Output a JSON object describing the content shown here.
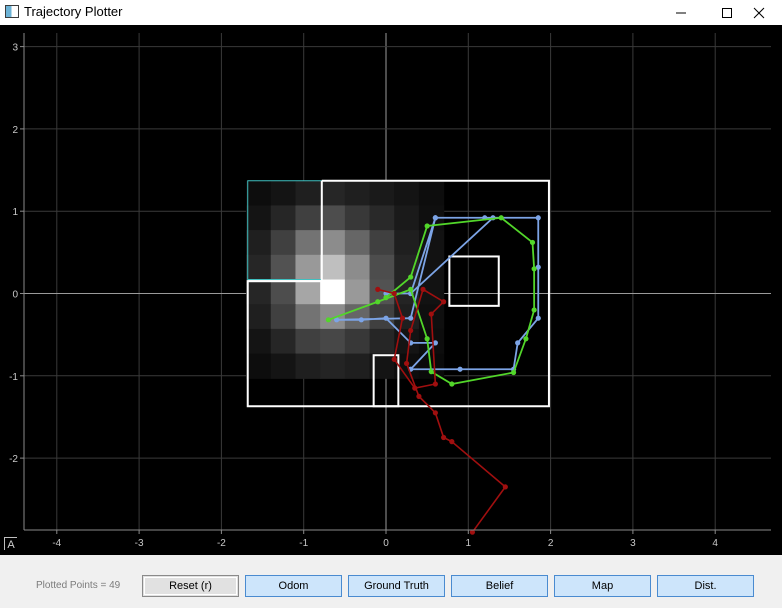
{
  "window": {
    "title": "Trajectory Plotter",
    "icons": [
      "app-icon",
      "minimize-icon",
      "maximize-icon",
      "close-icon"
    ]
  },
  "plot": {
    "x_ticks": [
      "-4",
      "-3",
      "-2",
      "-1",
      "0",
      "1",
      "2",
      "3",
      "4"
    ],
    "y_ticks": [
      "3",
      "2",
      "1",
      "0",
      "-1",
      "-2"
    ],
    "auto_range_label": "A",
    "colors": {
      "background": "#000000",
      "grid": "#3a3a3a",
      "axis": "#8a8a8a",
      "map_lines": "#ffffff",
      "odom": "#a00f0f",
      "ground_truth": "#52d62a",
      "belief": "#7ca4e6",
      "grid_highlight": "#40c0c0"
    }
  },
  "chart_data": {
    "type": "scatter",
    "xlim": [
      -4.4,
      4.7
    ],
    "ylim": [
      -2.9,
      3.1
    ],
    "grid": true,
    "series": [
      {
        "key": "belief",
        "points": [
          [
            0,
            0
          ],
          [
            0.3,
            0
          ],
          [
            0.6,
            0.92
          ],
          [
            1.2,
            0.92
          ],
          [
            1.85,
            0.92
          ],
          [
            1.85,
            0.32
          ],
          [
            1.85,
            -0.3
          ],
          [
            1.6,
            -0.6
          ],
          [
            1.55,
            -0.92
          ],
          [
            0.9,
            -0.92
          ],
          [
            0.3,
            -0.92
          ],
          [
            0.6,
            -0.6
          ],
          [
            0.3,
            -0.6
          ],
          [
            0,
            -0.3
          ],
          [
            -0.3,
            -0.32
          ],
          [
            -0.6,
            -0.32
          ],
          [
            0.3,
            -0.3
          ],
          [
            0.6,
            0.92
          ],
          [
            1.3,
            0.92
          ],
          [
            0.3,
            0
          ]
        ]
      },
      {
        "key": "ground_truth",
        "points": [
          [
            -0.7,
            -0.32
          ],
          [
            -0.1,
            -0.1
          ],
          [
            0.3,
            0.05
          ],
          [
            0.5,
            -0.55
          ],
          [
            0.55,
            -0.95
          ],
          [
            0.8,
            -1.1
          ],
          [
            1.55,
            -0.96
          ],
          [
            1.7,
            -0.55
          ],
          [
            1.8,
            -0.2
          ],
          [
            1.8,
            0.3
          ],
          [
            1.78,
            0.62
          ],
          [
            1.4,
            0.92
          ],
          [
            0.5,
            0.82
          ],
          [
            0.3,
            0.2
          ],
          [
            0,
            -0.05
          ]
        ]
      },
      {
        "key": "odom",
        "points": [
          [
            -0.1,
            0.05
          ],
          [
            0.1,
            0
          ],
          [
            0.2,
            -0.3
          ],
          [
            0.1,
            -0.8
          ],
          [
            0.35,
            -1.15
          ],
          [
            0.6,
            -1.1
          ],
          [
            0.55,
            -0.25
          ],
          [
            0.7,
            -0.1
          ],
          [
            0.45,
            0.05
          ],
          [
            0.3,
            -0.45
          ],
          [
            0.25,
            -0.85
          ],
          [
            0.4,
            -1.25
          ],
          [
            0.6,
            -1.45
          ],
          [
            0.7,
            -1.75
          ],
          [
            0.8,
            -1.8
          ],
          [
            1.45,
            -2.35
          ],
          [
            1.05,
            -2.9
          ]
        ]
      }
    ],
    "heatmap": {
      "origin": [
        -1.7,
        1.37
      ],
      "rows": [
        [
          0.05,
          0.08,
          0.12,
          0.15,
          0.12,
          0.1,
          0.08,
          0.05
        ],
        [
          0.08,
          0.15,
          0.25,
          0.3,
          0.22,
          0.16,
          0.1,
          0.06
        ],
        [
          0.12,
          0.25,
          0.45,
          0.55,
          0.4,
          0.25,
          0.12,
          0.07
        ],
        [
          0.15,
          0.32,
          0.6,
          0.75,
          0.55,
          0.3,
          0.14,
          0.07
        ],
        [
          0.15,
          0.3,
          0.65,
          1.0,
          0.6,
          0.32,
          0.14,
          0.07
        ],
        [
          0.12,
          0.25,
          0.45,
          0.55,
          0.4,
          0.25,
          0.12,
          0.06
        ],
        [
          0.08,
          0.15,
          0.25,
          0.28,
          0.22,
          0.15,
          0.08,
          0.05
        ],
        [
          0.05,
          0.08,
          0.12,
          0.14,
          0.12,
          0.08,
          0.05,
          0.04
        ]
      ]
    }
  },
  "status": {
    "plotted_points": "Plotted Points = 49"
  },
  "buttons": {
    "reset": "Reset (r)",
    "odom": "Odom",
    "ground_truth": "Ground Truth",
    "belief": "Belief",
    "map": "Map",
    "dist": "Dist."
  }
}
